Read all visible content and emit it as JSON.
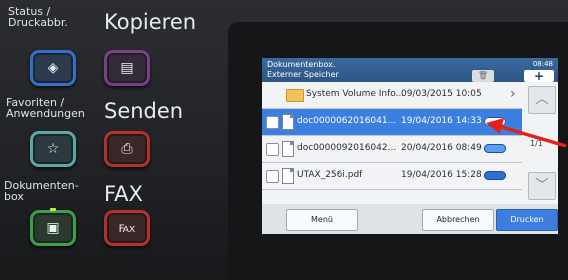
{
  "panel": {
    "status_label": "Status /\nDruckabbr.",
    "copy_label": "Kopieren",
    "favorites_label": "Favoriten /\nAnwendungen",
    "send_label": "Senden",
    "docbox_label": "Dokumenten-\nbox",
    "fax_label": "FAX",
    "icons": {
      "status": "eye-icon",
      "copy": "copy-icon",
      "favorites": "star-icon",
      "send": "send-icon",
      "docbox": "document-box-icon",
      "fax": "fax-icon"
    }
  },
  "screen": {
    "title": "Dokumentenbox.",
    "subtitle": "Externer Speicher",
    "time": "08:48",
    "add_label": "+",
    "page_counter": "1/1",
    "files": [
      {
        "name": "System Volume Info...",
        "date": "09/03/2015 10:05",
        "type": "folder",
        "selected": false
      },
      {
        "name": "doc00000620160​41...",
        "date": "19/04/2016 14:33",
        "type": "document",
        "selected": true
      },
      {
        "name": "doc0000092016042...",
        "date": "20/04/2016 08:49",
        "type": "document",
        "selected": false
      },
      {
        "name": "UTAX_256i.pdf",
        "date": "19/04/2016 15:28",
        "type": "document",
        "selected": false
      }
    ],
    "footer": {
      "menu_label": "Menü",
      "cancel_label": "Abbrechen",
      "print_label": "Drucken"
    }
  },
  "colors": {
    "header_blue": "#2c5583",
    "selection_blue": "#3b7fe0",
    "arrow_red": "#e3201b"
  }
}
